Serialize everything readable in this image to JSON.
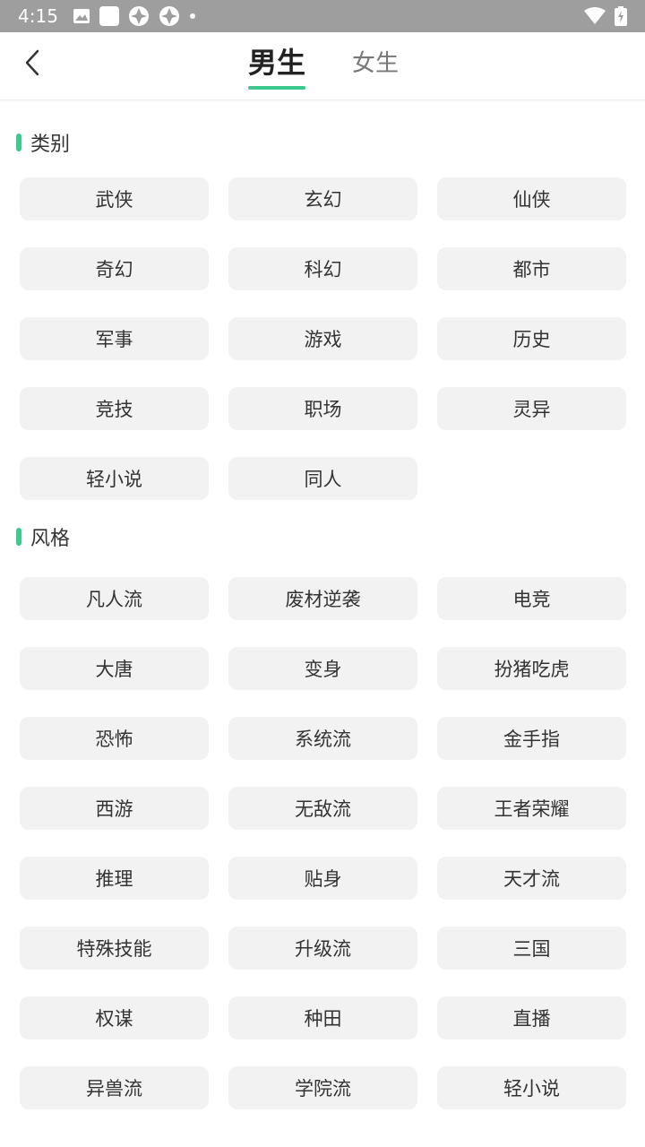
{
  "status_bar": {
    "time": "4:15",
    "icons": [
      "image-icon",
      "app-square-icon",
      "aperture-icon",
      "aperture-icon",
      "dot-icon",
      "wifi-icon",
      "battery-charging-icon"
    ]
  },
  "header": {
    "back_icon": "chevron-left-icon",
    "tabs": [
      {
        "label": "男生",
        "active": true
      },
      {
        "label": "女生",
        "active": false
      }
    ]
  },
  "sections": [
    {
      "title": "类别",
      "items": [
        "武侠",
        "玄幻",
        "仙侠",
        "奇幻",
        "科幻",
        "都市",
        "军事",
        "游戏",
        "历史",
        "竞技",
        "职场",
        "灵异",
        "轻小说",
        "同人"
      ]
    },
    {
      "title": "风格",
      "items": [
        "凡人流",
        "废材逆袭",
        "电竞",
        "大唐",
        "变身",
        "扮猪吃虎",
        "恐怖",
        "系统流",
        "金手指",
        "西游",
        "无敌流",
        "王者荣耀",
        "推理",
        "贴身",
        "天才流",
        "特殊技能",
        "升级流",
        "三国",
        "权谋",
        "种田",
        "直播",
        "异兽流",
        "学院流",
        "轻小说"
      ]
    }
  ],
  "colors": {
    "accent": "#3ec98f",
    "status_bar": "#9e9e9e",
    "chip_bg": "#f2f2f2"
  }
}
